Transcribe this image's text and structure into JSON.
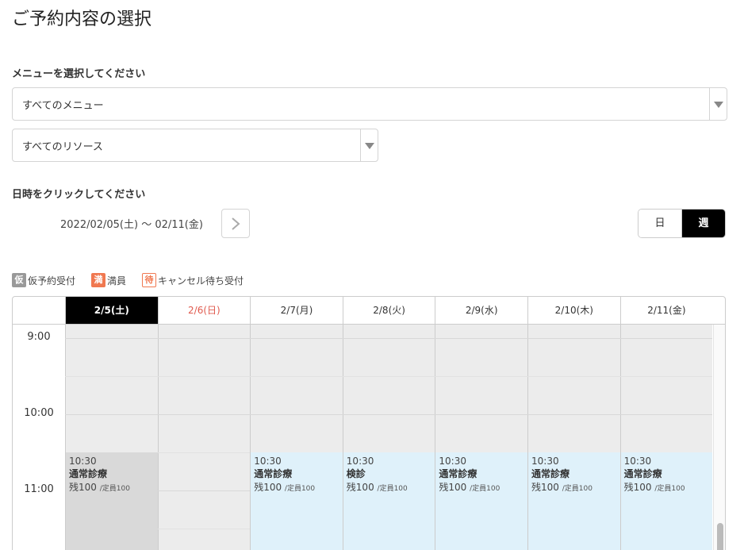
{
  "page": {
    "title": "ご予約内容の選択"
  },
  "menu_section": {
    "label": "メニューを選択してください",
    "menu_select": "すべてのメニュー",
    "resource_select": "すべてのリソース"
  },
  "date_section": {
    "label": "日時をクリックしてください",
    "range": "2022/02/05(土) 〜 02/11(金)"
  },
  "view_toggle": {
    "day": "日",
    "week": "週",
    "active": "week"
  },
  "legend": [
    {
      "badge": "仮",
      "label": "仮予約受付"
    },
    {
      "badge": "満",
      "label": "満員"
    },
    {
      "badge": "待",
      "label": "キャンセル待ち受付"
    }
  ],
  "calendar": {
    "days": [
      {
        "label": "2/5(土)",
        "state": "selected"
      },
      {
        "label": "2/6(日)",
        "state": "sunday"
      },
      {
        "label": "2/7(月)",
        "state": "normal"
      },
      {
        "label": "2/8(火)",
        "state": "normal"
      },
      {
        "label": "2/9(水)",
        "state": "normal"
      },
      {
        "label": "2/10(木)",
        "state": "normal"
      },
      {
        "label": "2/11(金)",
        "state": "normal"
      }
    ],
    "times": [
      "9:00",
      "10:00",
      "11:00"
    ],
    "slots": [
      {
        "day": 0,
        "time": "10:30",
        "name": "通常診療",
        "remaining": "残100",
        "capacity": "/定員100",
        "state": "past"
      },
      {
        "day": 2,
        "time": "10:30",
        "name": "通常診療",
        "remaining": "残100",
        "capacity": "/定員100",
        "state": "available"
      },
      {
        "day": 3,
        "time": "10:30",
        "name": "検診",
        "remaining": "残100",
        "capacity": "/定員100",
        "state": "available"
      },
      {
        "day": 4,
        "time": "10:30",
        "name": "通常診療",
        "remaining": "残100",
        "capacity": "/定員100",
        "state": "available"
      },
      {
        "day": 5,
        "time": "10:30",
        "name": "通常診療",
        "remaining": "残100",
        "capacity": "/定員100",
        "state": "available"
      },
      {
        "day": 6,
        "time": "10:30",
        "name": "通常診療",
        "remaining": "残100",
        "capacity": "/定員100",
        "state": "available"
      }
    ]
  },
  "icons": {
    "next": "chevron-right-icon",
    "select_arrow": "triangle-down-icon"
  },
  "colors": {
    "selected_day_bg": "#000000",
    "sunday_text": "#e05a4e",
    "available_slot": "#dff1fa",
    "past_slot": "#d9d9d9",
    "badge_full": "#f07850",
    "badge_provisional": "#999999"
  }
}
